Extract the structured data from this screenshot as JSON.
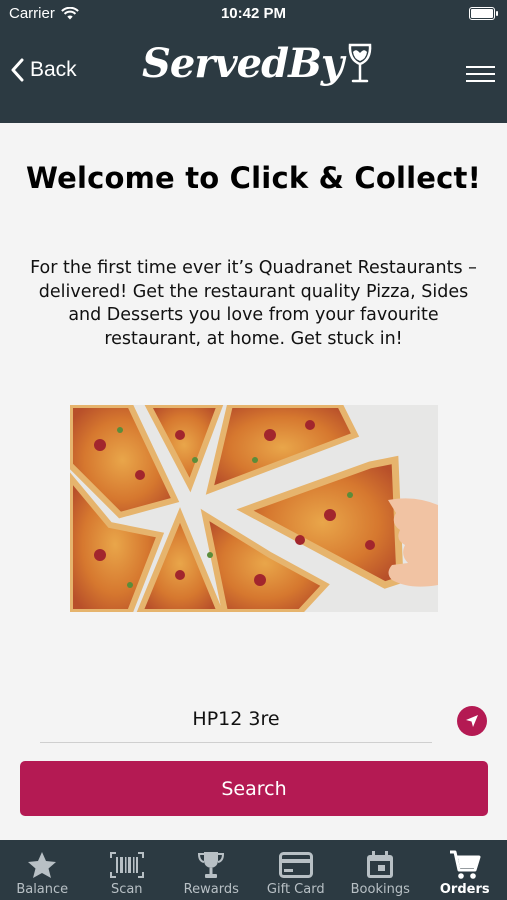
{
  "status_bar": {
    "carrier": "Carrier",
    "time": "10:42 PM"
  },
  "nav": {
    "back_label": "Back",
    "logo_text": "ServedBy"
  },
  "main": {
    "title": "Welcome to Click & Collect!",
    "intro": "For the first time ever it’s Quadranet Restaurants – delivered! Get the restaurant quality Pizza, Sides and Desserts you love from your favourite restaurant, at home. Get stuck in!",
    "postcode_value": "HP12 3re",
    "search_label": "Search"
  },
  "colors": {
    "header_bg": "#2c3a42",
    "accent": "#b41a53",
    "page_bg": "#f4f4f4"
  },
  "tabs": [
    {
      "label": "Balance",
      "icon": "star-icon"
    },
    {
      "label": "Scan",
      "icon": "barcode-icon"
    },
    {
      "label": "Rewards",
      "icon": "trophy-icon"
    },
    {
      "label": "Gift Card",
      "icon": "credit-card-icon"
    },
    {
      "label": "Bookings",
      "icon": "calendar-icon"
    },
    {
      "label": "Orders",
      "icon": "cart-icon",
      "active": true
    }
  ]
}
